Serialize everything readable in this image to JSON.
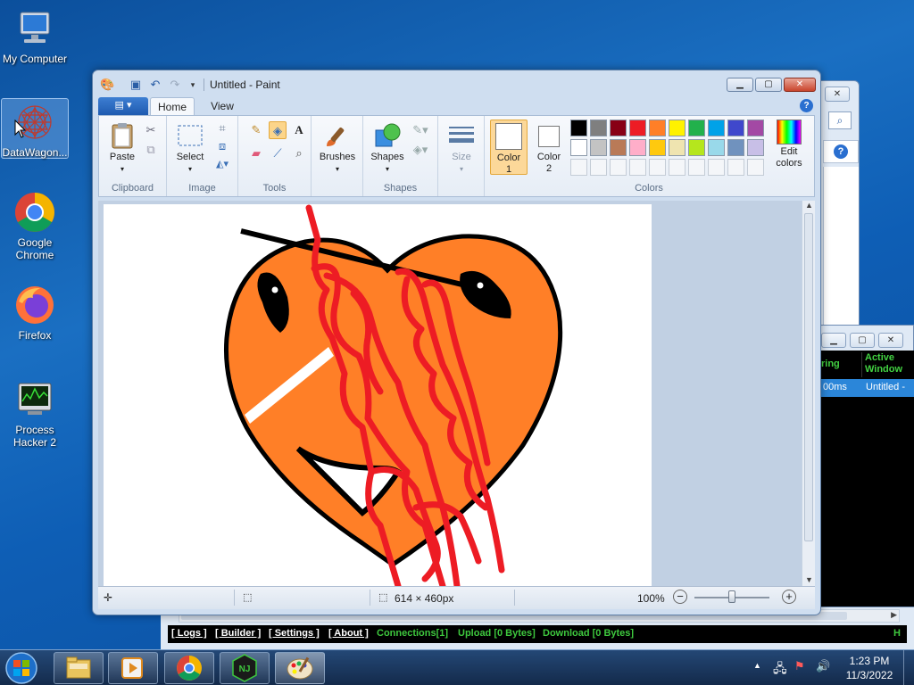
{
  "desktop": {
    "icons": [
      {
        "label": "My Computer"
      },
      {
        "label": "DataWagon..."
      },
      {
        "label": "Google Chrome"
      },
      {
        "label": "Firefox"
      },
      {
        "label": "Process Hacker 2"
      }
    ]
  },
  "rat_panel": {
    "col_ping": "ring",
    "col_active_window": "Active Window",
    "row_ping": "00ms",
    "row_window": "Untitled -",
    "menu": {
      "logs": "[ Logs ]",
      "builder": "[ Builder ]",
      "settings": "[ Settings ]",
      "about": "[ About ]",
      "connections": "Connections[1]",
      "upload": "Upload [0 Bytes]",
      "download": "Download [0 Bytes]",
      "right_letter": "H"
    }
  },
  "paint": {
    "title": "Untitled - Paint",
    "tabs": {
      "home": "Home",
      "view": "View"
    },
    "groups": {
      "clipboard": "Clipboard",
      "image": "Image",
      "tools": "Tools",
      "shapes": "Shapes",
      "colors": "Colors"
    },
    "buttons": {
      "paste": "Paste",
      "select": "Select",
      "brushes": "Brushes",
      "shapes": "Shapes",
      "size": "Size",
      "color1": "Color 1",
      "color2": "Color 2",
      "edit_colors": "Edit colors"
    },
    "palette_row1": [
      "#000000",
      "#7f7f7f",
      "#880015",
      "#ed1c24",
      "#ff7f27",
      "#fff200",
      "#22b14c",
      "#00a2e8",
      "#3f48cc",
      "#a349a4"
    ],
    "palette_row2": [
      "#ffffff",
      "#c3c3c3",
      "#b97a57",
      "#ffaec9",
      "#ffc90e",
      "#efe4b0",
      "#b5e61d",
      "#99d9ea",
      "#7092be",
      "#c8bfe7"
    ],
    "status": {
      "image_size": "614 × 460px",
      "zoom": "100%"
    }
  },
  "taskbar": {
    "time": "1:23 PM",
    "date": "11/3/2022"
  }
}
